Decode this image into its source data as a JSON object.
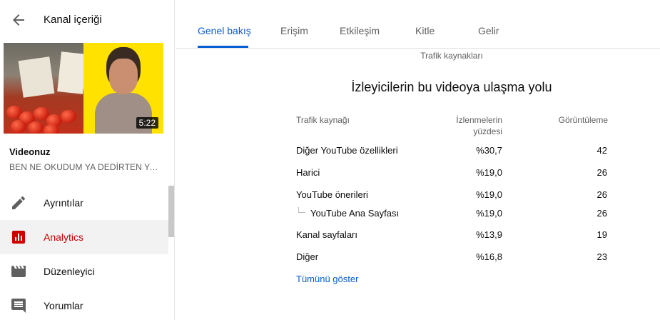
{
  "sidebar": {
    "title": "Kanal içeriği",
    "video": {
      "duration": "5:22",
      "label": "Videonuz",
      "title": "BEN NE OKUDUM YA DEDİRTEN YAZ..."
    },
    "nav": [
      {
        "label": "Ayrıntılar",
        "icon": "pencil-icon"
      },
      {
        "label": "Analytics",
        "icon": "analytics-icon",
        "active": true
      },
      {
        "label": "Düzenleyici",
        "icon": "clapperboard-icon"
      },
      {
        "label": "Yorumlar",
        "icon": "comment-icon"
      }
    ]
  },
  "tabs": [
    "Genel bakış",
    "Erişim",
    "Etkileşim",
    "Kitle",
    "Gelir"
  ],
  "card": {
    "subtitle": "Trafik kaynakları",
    "title": "İzleyicilerin bu videoya ulaşma yolu",
    "headers": {
      "source": "Trafik kaynağı",
      "percent_line1": "İzlenmelerin",
      "percent_line2": "yüzdesi",
      "views": "Görüntüleme"
    },
    "rows": [
      {
        "source": "Diğer YouTube özellikleri",
        "percent": "%30,7",
        "views": "42"
      },
      {
        "source": "Harici",
        "percent": "%19,0",
        "views": "26"
      },
      {
        "source": "YouTube önerileri",
        "percent": "%19,0",
        "views": "26"
      },
      {
        "source": "YouTube Ana Sayfası",
        "percent": "%19,0",
        "views": "26",
        "sub": true
      },
      {
        "source": "Kanal sayfaları",
        "percent": "%13,9",
        "views": "19"
      },
      {
        "source": "Diğer",
        "percent": "%16,8",
        "views": "23"
      }
    ],
    "show_all": "Tümünü göster"
  },
  "colors": {
    "accent_blue": "#065fd4",
    "active_red": "#cc0000"
  }
}
